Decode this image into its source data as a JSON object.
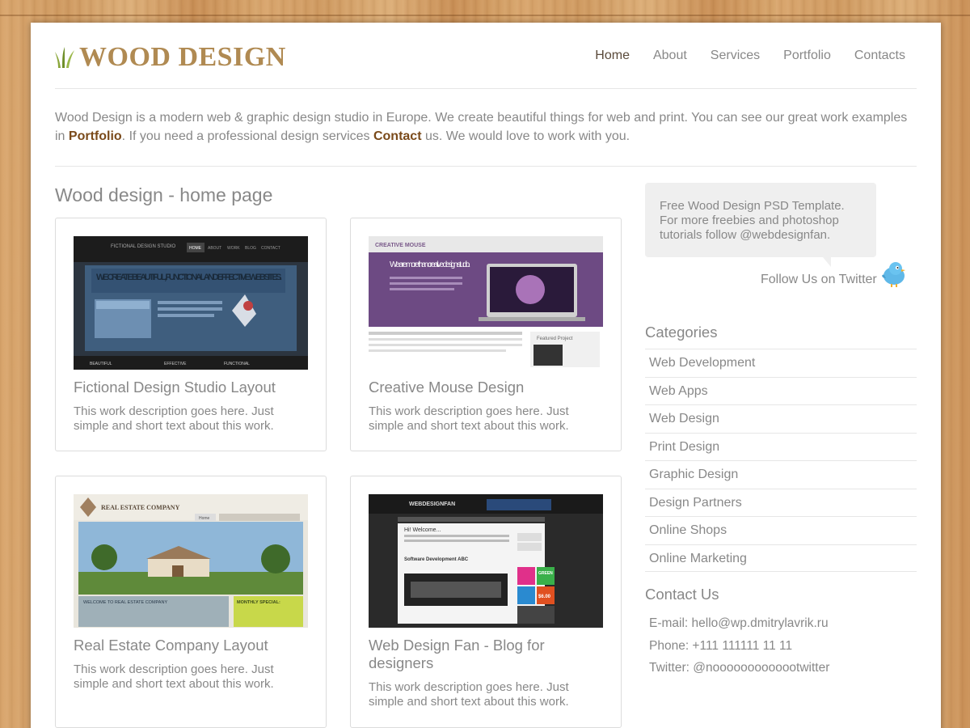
{
  "logo": {
    "text": "WOOD DESIGN",
    "icon": "grass-icon",
    "color": "#b08a52"
  },
  "nav": {
    "items": [
      {
        "label": "Home",
        "active": true
      },
      {
        "label": "About",
        "active": false
      },
      {
        "label": "Services",
        "active": false
      },
      {
        "label": "Portfolio",
        "active": false
      },
      {
        "label": "Contacts",
        "active": false
      }
    ]
  },
  "intro": {
    "part1": "Wood Design is a modern web & graphic design studio in Europe. We create beautiful things for web and print. You can see our great work examples in ",
    "link1": "Portfolio",
    "part2": ". If you need a professional design services ",
    "link2": "Contact",
    "part3": " us. We would love to work with you."
  },
  "main": {
    "title": "Wood design - home page",
    "cards": [
      {
        "title": "Fictional Design Studio Layout",
        "description": "This work description goes here. Just simple and short text about this work.",
        "thumb": {
          "logo": "FICTIONAL DESIGN STUDIO",
          "nav": [
            "HOME",
            "ABOUT",
            "WORK",
            "BLOG",
            "CONTACT"
          ],
          "headline": "WE CREATE BEAUTIFUL, FUNCTIONAL AND EFFECTIVE WEBSITES.",
          "footer": [
            "BEAUTIFUL",
            "EFFECTIVE",
            "FUNCTIONAL"
          ]
        }
      },
      {
        "title": "Creative Mouse Design",
        "description": "This work description goes here. Just simple and short text about this work.",
        "thumb": {
          "logo": "CREATIVE MOUSE",
          "headline": "We are more than creative design studio.",
          "featured": "Featured Project"
        }
      },
      {
        "title": "Real Estate Company Layout",
        "description": "This work description goes here. Just simple and short text about this work.",
        "thumb": {
          "logo": "REAL ESTATE COMPANY",
          "tab": "Home",
          "welcome": "WELCOME TO REAL ESTATE COMPANY",
          "special": "MONTHLY SPECIAL:"
        }
      },
      {
        "title": "Web Design Fan - Blog for designers",
        "description": "This work description goes here. Just simple and short text about this work.",
        "thumb": {
          "logo": "WEBDESIGNFAN",
          "welcome": "Hi! Welcome...",
          "post": "Software Development ABC",
          "ads": [
            "GREEN",
            "$6.00"
          ]
        }
      }
    ]
  },
  "sidebar": {
    "bubble_text": "Free Wood Design PSD Template. For more freebies and photoshop tutorials follow @webdesignfan.",
    "follow_label": "Follow Us on Twitter",
    "categories_title": "Categories",
    "categories": [
      "Web Development",
      "Web Apps",
      "Web Design",
      "Print Design",
      "Graphic Design",
      "Design Partners",
      "Online Shops",
      "Online Marketing"
    ],
    "contact_title": "Contact Us",
    "contact": {
      "email": "E-mail: hello@wp.dmitrylavrik.ru",
      "phone": "Phone: +111 111111 11 11",
      "twitter": "Twitter: @nooooooooooootwitter"
    }
  }
}
